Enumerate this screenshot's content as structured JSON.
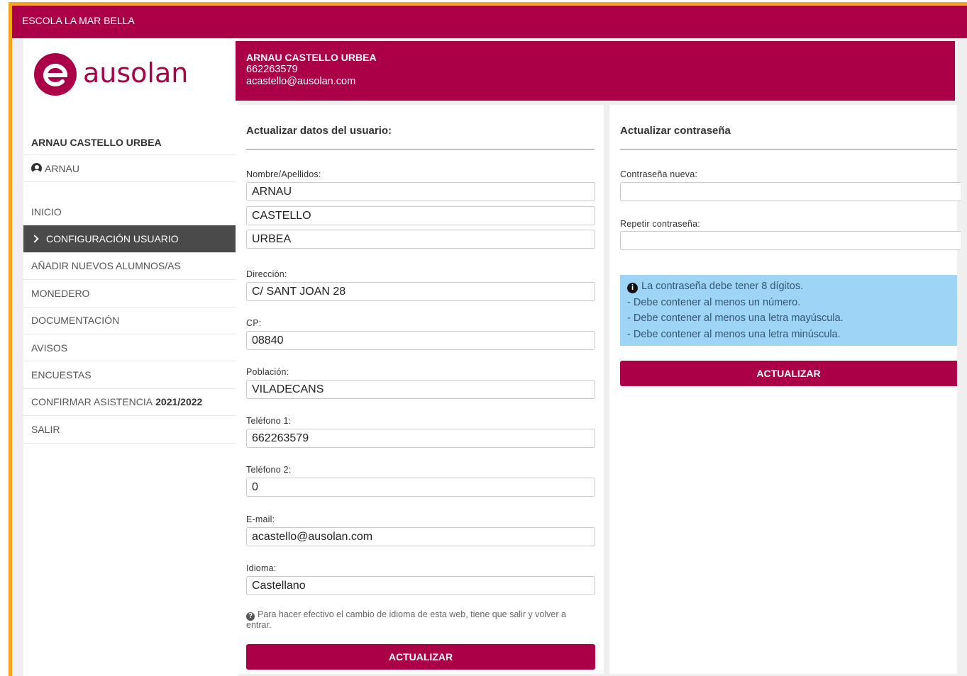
{
  "topbar": {
    "school": "ESCOLA LA MAR BELLA"
  },
  "logo": {
    "text": "ausolan"
  },
  "sidebar": {
    "user_name": "ARNAU CASTELLO URBEA",
    "user_short": "ARNAU",
    "menu": [
      {
        "label": "INICIO"
      },
      {
        "label": "CONFIGURACIÓN USUARIO",
        "active": true
      },
      {
        "label": "AÑADIR NUEVOS ALUMNOS/AS"
      },
      {
        "label": "MONEDERO"
      },
      {
        "label": "DOCUMENTACIÓN"
      },
      {
        "label": "AVISOS"
      },
      {
        "label": "ENCUESTAS"
      },
      {
        "label": "CONFIRMAR ASISTENCIA",
        "bold": "2021/2022"
      },
      {
        "label": "SALIR"
      }
    ]
  },
  "userbar": {
    "name": "ARNAU CASTELLO URBEA",
    "phone": "662263579",
    "email": "acastello@ausolan.com"
  },
  "user_form": {
    "title": "Actualizar datos del usuario:",
    "name_label": "Nombre/Apellidos:",
    "first_name": "ARNAU",
    "surname1": "CASTELLO",
    "surname2": "URBEA",
    "address_label": "Dirección:",
    "address": "C/ SANT JOAN 28",
    "cp_label": "CP:",
    "cp": "08840",
    "city_label": "Población:",
    "city": "VILADECANS",
    "phone1_label": "Teléfono 1:",
    "phone1": "662263579",
    "phone2_label": "Teléfono 2:",
    "phone2": "0",
    "email_label": "E-mail:",
    "email": "acastello@ausolan.com",
    "language_label": "Idioma:",
    "language": "Castellano",
    "help_text": "Para hacer efectivo el cambio de idioma de esta web, tiene que salir y volver a entrar.",
    "submit": "ACTUALIZAR"
  },
  "password_form": {
    "title": "Actualizar contraseña",
    "new_label": "Contraseña nueva:",
    "new_value": "",
    "repeat_label": "Repetir contraseña:",
    "repeat_value": "",
    "rules": [
      "La contraseña debe tener 8 dígitos.",
      "- Debe contener al menos un número.",
      "- Debe contener al menos una letra mayúscula.",
      "- Debe contener al menos una letra minúscula."
    ],
    "submit": "ACTUALIZAR"
  },
  "colors": {
    "brand": "#ab0048",
    "accent_border": "#f7a21b",
    "info_bg": "#9ed4f5",
    "active_menu": "#4a4a4a"
  }
}
